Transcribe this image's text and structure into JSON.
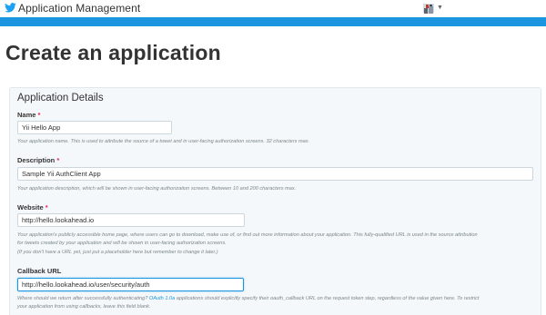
{
  "header": {
    "app_title": "Application Management",
    "colors": {
      "brand_blue": "#1b95e0",
      "twitter_bird": "#1da1f2"
    }
  },
  "page": {
    "title": "Create an application"
  },
  "panel": {
    "title": "Application Details",
    "fields": {
      "name": {
        "label": "Name",
        "required_mark": "*",
        "value": "Yii Hello App",
        "help": "Your application name. This is used to attribute the source of a tweet and in user-facing authorization screens. 32 characters max."
      },
      "description": {
        "label": "Description",
        "required_mark": "*",
        "value": "Sample Yii AuthClient App",
        "help": "Your application description, which will be shown in user-facing authorization screens. Between 10 and 200 characters max."
      },
      "website": {
        "label": "Website",
        "required_mark": "*",
        "value": "http://hello.lookahead.io",
        "help_line1": "Your application's publicly accessible home page, where users can go to download, make use of, or find out more information about your application. This fully-qualified URL is used in the source attribution",
        "help_line2": "for tweets created by your application and will be shown in user-facing authorization screens.",
        "help_line3": "(If you don't have a URL yet, just put a placeholder here but remember to change it later.)"
      },
      "callback": {
        "label": "Callback URL",
        "value": "http://hello.lookahead.io/user/security/auth",
        "help_line1_before": "Where should we return after successfully authenticating?",
        "help_line1_link": "OAuth 1.0a",
        "help_line1_after": "applications should explicitly specify their oauth_callback URL on the request token step, regardless of the value given here. To restrict",
        "help_line2": "your application from using callbacks, leave this field blank."
      }
    }
  }
}
